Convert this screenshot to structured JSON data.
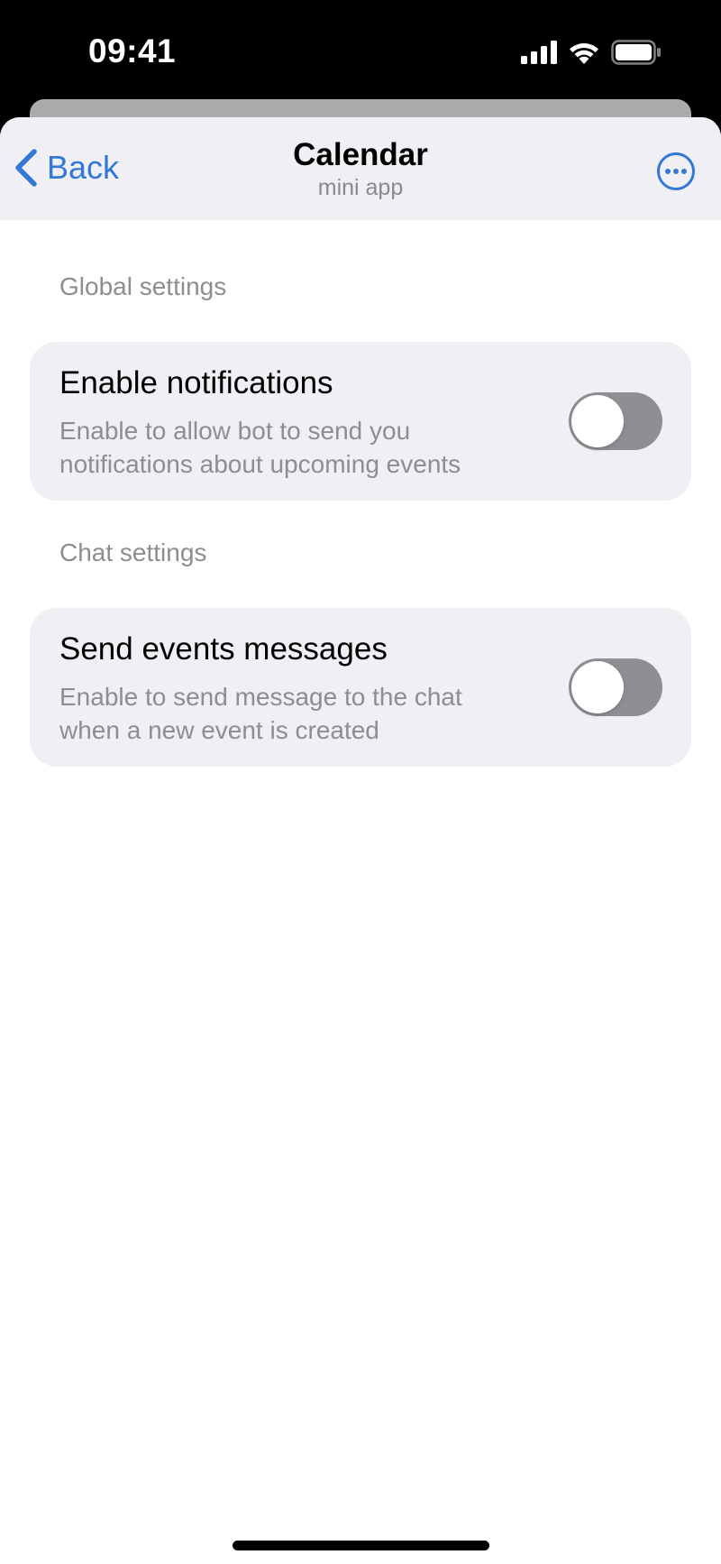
{
  "status_bar": {
    "time": "09:41",
    "icons": [
      "cellular-signal-icon",
      "wifi-icon",
      "battery-icon"
    ]
  },
  "header": {
    "back_label": "Back",
    "title": "Calendar",
    "subtitle": "mini app",
    "more_icon": "more-icon"
  },
  "sections": [
    {
      "title": "Global settings",
      "item": {
        "title": "Enable notifications",
        "description": "Enable to allow bot to send you notifications about upcoming events",
        "enabled": false
      }
    },
    {
      "title": "Chat settings",
      "item": {
        "title": "Send events messages",
        "description": "Enable to send message to the chat when a new event is created",
        "enabled": false
      }
    }
  ],
  "colors": {
    "accent": "#3478d6",
    "header_bg": "#efeff4",
    "card_bg": "#efeff4",
    "toggle_off": "#8e8e93",
    "secondary_text": "#8d8d92"
  }
}
